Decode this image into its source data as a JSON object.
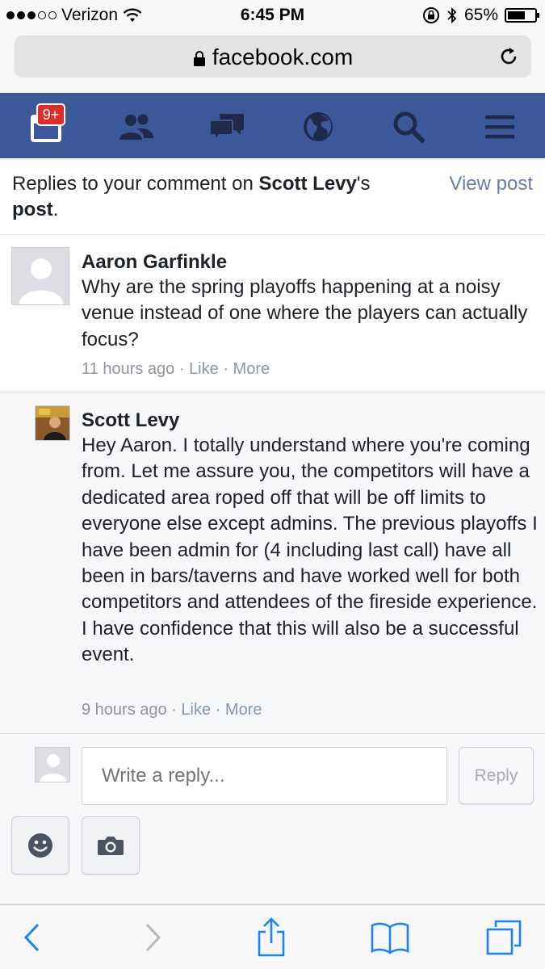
{
  "status_bar": {
    "carrier": "Verizon",
    "time": "6:45 PM",
    "battery": "65%",
    "battery_level": 0.65
  },
  "browser": {
    "url": "facebook.com"
  },
  "fb_nav": {
    "notification_badge": "9+",
    "icons": [
      "notifications-icon",
      "friends-icon",
      "messages-icon",
      "globe-icon",
      "search-icon",
      "menu-icon"
    ]
  },
  "header": {
    "prefix": "Replies to your comment on ",
    "author": "Scott Levy",
    "possessive": "'s",
    "post_word": "post",
    "period": ".",
    "view_post": "View post"
  },
  "comments": [
    {
      "name": "Aaron Garfinkle",
      "text": "Why are the spring playoffs happening at a noisy venue instead of one where the players can actually focus?",
      "time": "11 hours ago",
      "sep": " · ",
      "like": "Like",
      "more": "More"
    },
    {
      "name": "Scott Levy",
      "text": "Hey Aaron. I totally understand where you're coming from. Let me assure you, the competitors will have a dedicated area roped off that will be off limits to everyone else except admins. The previous playoffs I have been admin for (4 including last call) have all been in bars/taverns and have worked well for both competitors and attendees of the fireside experience. I have confidence that this will also be a successful event.",
      "time": "9 hours ago",
      "sep": " · ",
      "like": "Like",
      "more": "More"
    }
  ],
  "composer": {
    "placeholder": "Write a reply...",
    "reply_label": "Reply"
  },
  "colors": {
    "fb_blue": "#3b5998",
    "badge_red": "#e02b2b",
    "link_gray": "#8a96ad",
    "ios_blue": "#1a82fb"
  }
}
